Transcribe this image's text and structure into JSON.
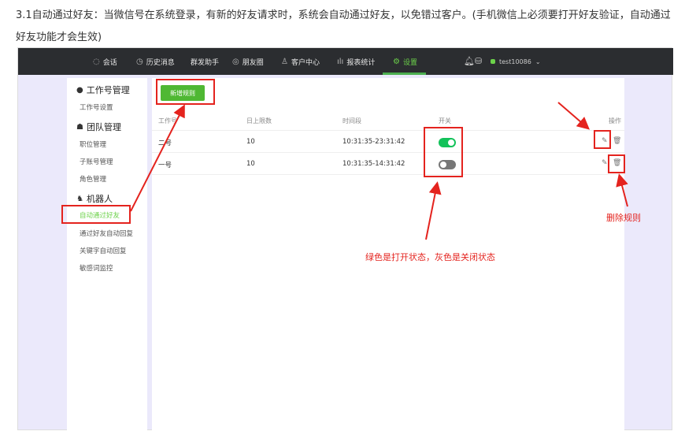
{
  "intro": "3.1自动通过好友：当微信号在系统登录，有新的好友请求时，系统会自动通过好友，以免错过客户。(手机微信上必须要打开好友验证，自动通过好友功能才会生效)",
  "topnav": [
    {
      "label": "会话",
      "icon": "chat-icon",
      "glyph": "◌"
    },
    {
      "label": "历史消息",
      "icon": "clock-icon",
      "glyph": "◷"
    },
    {
      "label": "群发助手",
      "icon": "",
      "glyph": ""
    },
    {
      "label": "朋友圈",
      "icon": "moments-icon",
      "glyph": "◎"
    },
    {
      "label": "客户中心",
      "icon": "user-icon",
      "glyph": "♙"
    },
    {
      "label": "报表统计",
      "icon": "bar-chart-icon",
      "glyph": "ılı"
    },
    {
      "label": "设置",
      "icon": "gear-icon",
      "glyph": "⚙"
    }
  ],
  "user": {
    "name": "test10086"
  },
  "sidebar": {
    "groups": [
      {
        "title": "工作号管理",
        "icon": "wechat-icon",
        "items": [
          "工作号设置"
        ]
      },
      {
        "title": "团队管理",
        "icon": "team-icon",
        "items": [
          "职位管理",
          "子账号管理",
          "角色管理"
        ]
      },
      {
        "title": "机器人",
        "icon": "robot-icon",
        "items": [
          "自动通过好友",
          "通过好友自动回复",
          "关键字自动回复",
          "敏感词监控"
        ]
      }
    ]
  },
  "main": {
    "add_button": "新增规则",
    "headers": [
      "工作号",
      "日上限数",
      "时间段",
      "开关",
      "操作"
    ],
    "rows": [
      {
        "account": "二号",
        "limit": "10",
        "period": "10:31:35-23:31:42",
        "enabled": true
      },
      {
        "account": "一号",
        "limit": "10",
        "period": "10:31:35-14:31:42",
        "enabled": false
      }
    ]
  },
  "annotations": {
    "toggle_note": "绿色是打开状态，灰色是关闭状态",
    "delete_note": "删除规则"
  },
  "colors": {
    "highlight": "#e4231e",
    "accent": "#4fb833",
    "toggle_on": "#13c25a",
    "toggle_off": "#777777",
    "topbar": "#2b2d30"
  }
}
